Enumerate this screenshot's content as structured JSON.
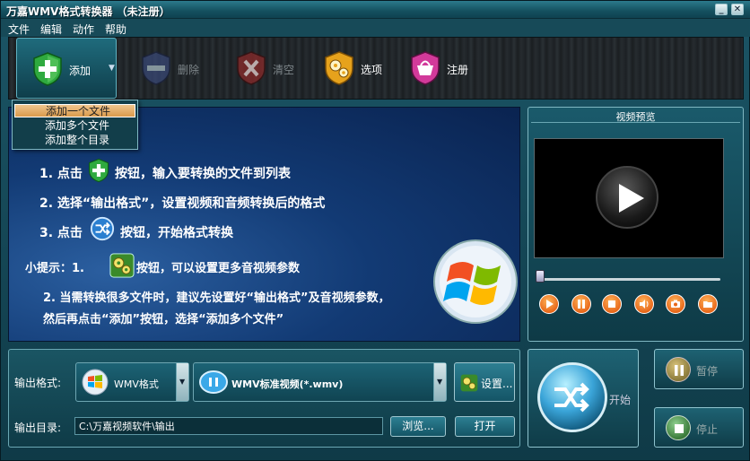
{
  "window": {
    "title": "万嘉WMV格式转换器 （未注册）"
  },
  "menu": [
    "文件",
    "编辑",
    "动作",
    "帮助"
  ],
  "toolbar": {
    "add": "添加",
    "delete": "删除",
    "clear": "清空",
    "options": "选项",
    "register": "注册"
  },
  "add_menu": {
    "items": [
      "添加一个文件",
      "添加多个文件",
      "添加整个目录"
    ],
    "selected_index": 0
  },
  "guide": {
    "step1_prefix": "1. 点击",
    "step1_suffix": "按钮，输入要转换的文件到列表",
    "step2": "2. 选择“输出格式”，设置视频和音频转换后的格式",
    "step3_prefix": "3. 点击",
    "step3_suffix": "按钮，开始格式转换",
    "tip_prefix": "小提示：1.",
    "tip1_suffix": "按钮，可以设置更多音视频参数",
    "tip2_line1": "2. 当需转换很多文件时，建议先设置好“输出格式”及音视频参数，",
    "tip2_line2": "然后再点击“添加”按钮，选择“添加多个文件”"
  },
  "preview": {
    "title": "视频预览"
  },
  "output": {
    "format_label": "输出格式:",
    "format_value": "WMV格式",
    "profile_value": "WMV标准视频(*.wmv)",
    "settings_button": "设置...",
    "dir_label": "输出目录:",
    "dir_value": "C:\\万嘉视频软件\\输出",
    "browse_button": "浏览...",
    "open_button": "打开"
  },
  "actions": {
    "start": "开始",
    "pause": "暂停",
    "stop": "停止"
  }
}
